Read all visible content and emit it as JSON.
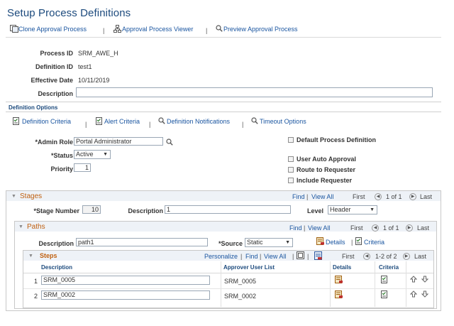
{
  "page": {
    "title": "Setup Process Definitions"
  },
  "toolbar": {
    "clone": "Clone Approval Process",
    "viewer": "Approval Process Viewer",
    "preview": "Preview Approval Process",
    "sep": "|"
  },
  "header": {
    "process_id_label": "Process ID",
    "process_id_value": "SRM_AWE_H",
    "definition_id_label": "Definition ID",
    "definition_id_value": "test1",
    "effective_date_label": "Effective Date",
    "effective_date_value": "10/11/2019",
    "description_label": "Description",
    "description_value": ""
  },
  "definition_options": {
    "heading": "Definition Options",
    "links": [
      "Definition Criteria",
      "Alert Criteria",
      "Definition Notifications",
      "Timeout Options"
    ],
    "admin_role_label": "*Admin Role",
    "admin_role_value": "Portal Administrator",
    "status_label": "*Status",
    "status_value": "Active",
    "priority_label": "Priority",
    "priority_value": "1",
    "checkboxes": [
      "Default Process Definition",
      "User Auto Approval",
      "Route to Requester",
      "Include Requester"
    ]
  },
  "stages": {
    "title": "Stages",
    "find": "Find",
    "view_all": "View All",
    "first": "First",
    "range": "1 of 1",
    "last": "Last",
    "stage_number_label": "*Stage Number",
    "stage_number_value": "10",
    "description_label": "Description",
    "description_value": "1",
    "level_label": "Level",
    "level_value": "Header"
  },
  "paths": {
    "title": "Paths",
    "find": "Find",
    "view_all": "View All",
    "first": "First",
    "range": "1 of 1",
    "last": "Last",
    "description_label": "Description",
    "description_value": "path1",
    "source_label": "*Source",
    "source_value": "Static",
    "details_link": "Details",
    "criteria_link": "Criteria"
  },
  "steps": {
    "title": "Steps",
    "personalize": "Personalize",
    "find": "Find",
    "view_all": "View All",
    "first": "First",
    "range": "1-2 of 2",
    "last": "Last",
    "columns": [
      "Description",
      "Approver User List",
      "Details",
      "Criteria"
    ],
    "rows": [
      {
        "num": "1",
        "description": "SRM_0005",
        "approver": "SRM_0005"
      },
      {
        "num": "2",
        "description": "SRM_0002",
        "approver": "SRM_0002"
      }
    ]
  },
  "colors": {
    "title": "#1c4a7d",
    "link": "#1a55a0",
    "section": "#c06010"
  }
}
